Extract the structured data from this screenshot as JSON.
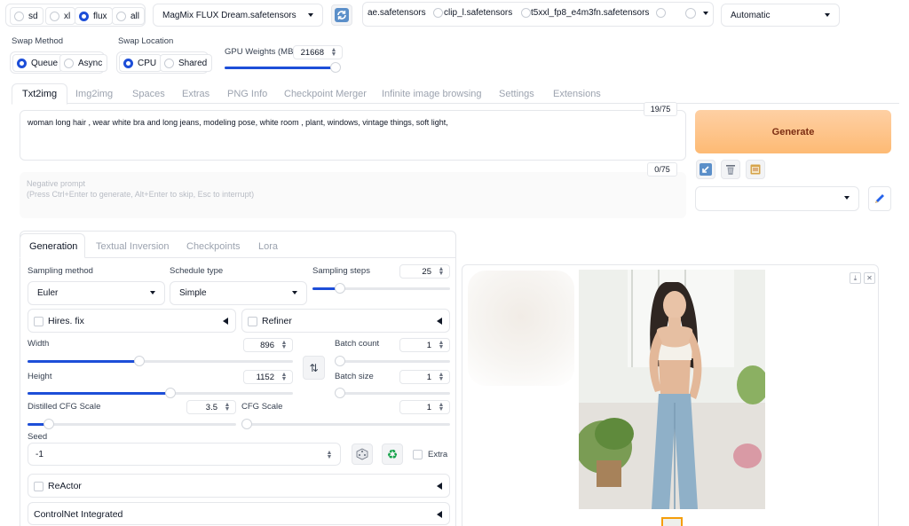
{
  "top": {
    "model_type_options": [
      "sd",
      "xl",
      "flux",
      "all"
    ],
    "model_type_selected": "flux",
    "checkpoint": "MagMix FLUX Dream.safetensors",
    "text_encoders": [
      "ae.safetensors",
      "clip_l.safetensors",
      "t5xxl_fp8_e4m3fn.safetensors"
    ],
    "vae_mode": "Automatic"
  },
  "swap": {
    "method_label": "Swap Method",
    "method_options": [
      "Queue",
      "Async"
    ],
    "method_selected": "Queue",
    "location_label": "Swap Location",
    "location_options": [
      "CPU",
      "Shared"
    ],
    "location_selected": "CPU",
    "gpu_weights_label": "GPU Weights (MB)",
    "gpu_weights_value": "21668",
    "gpu_weights_fraction": 0.96
  },
  "main_tabs": [
    "Txt2img",
    "Img2img",
    "Spaces",
    "Extras",
    "PNG Info",
    "Checkpoint Merger",
    "Infinite image browsing",
    "Settings",
    "Extensions"
  ],
  "main_tab_active": "Txt2img",
  "prompt": {
    "text": "woman long hair ,  wear white bra and long jeans, modeling pose, white room , plant, windows, vintage things, soft light,",
    "token_count": "19/75",
    "negative_placeholder_line1": "Negative prompt",
    "negative_placeholder_line2": "(Press Ctrl+Enter to generate, Alt+Enter to skip, Esc to interrupt)",
    "negative_token_count": "0/75"
  },
  "generate_label": "Generate",
  "colors": {
    "accent": "#1d4ed8",
    "generate_start": "#fdba74",
    "generate_end": "#fed7aa"
  },
  "sub_tabs": [
    "Generation",
    "Textual Inversion",
    "Checkpoints",
    "Lora"
  ],
  "sub_tab_active": "Generation",
  "params": {
    "sampling_method_label": "Sampling method",
    "sampling_method": "Euler",
    "schedule_type_label": "Schedule type",
    "schedule_type": "Simple",
    "sampling_steps_label": "Sampling steps",
    "sampling_steps": "25",
    "sampling_steps_fraction": 0.2,
    "hires_fix_label": "Hires. fix",
    "refiner_label": "Refiner",
    "width_label": "Width",
    "width": "896",
    "width_fraction": 0.42,
    "height_label": "Height",
    "height": "1152",
    "height_fraction": 0.54,
    "batch_count_label": "Batch count",
    "batch_count": "1",
    "batch_size_label": "Batch size",
    "batch_size": "1",
    "distilled_cfg_label": "Distilled CFG Scale",
    "distilled_cfg": "3.5",
    "distilled_cfg_fraction": 0.1,
    "cfg_scale_label": "CFG Scale",
    "cfg_scale": "1",
    "seed_label": "Seed",
    "seed": "-1",
    "extra_label": "Extra"
  },
  "accordions": [
    "ReActor",
    "ControlNet Integrated"
  ],
  "icons": {
    "refresh": "refresh-icon",
    "paste": "paste-icon",
    "trash": "trash-icon",
    "clipboard": "clipboard-icon",
    "pencil": "pencil-icon",
    "dice": "dice-icon",
    "recycle": "recycle-icon",
    "swap": "swap-dimensions-icon",
    "download": "download-icon",
    "close": "close-icon"
  }
}
